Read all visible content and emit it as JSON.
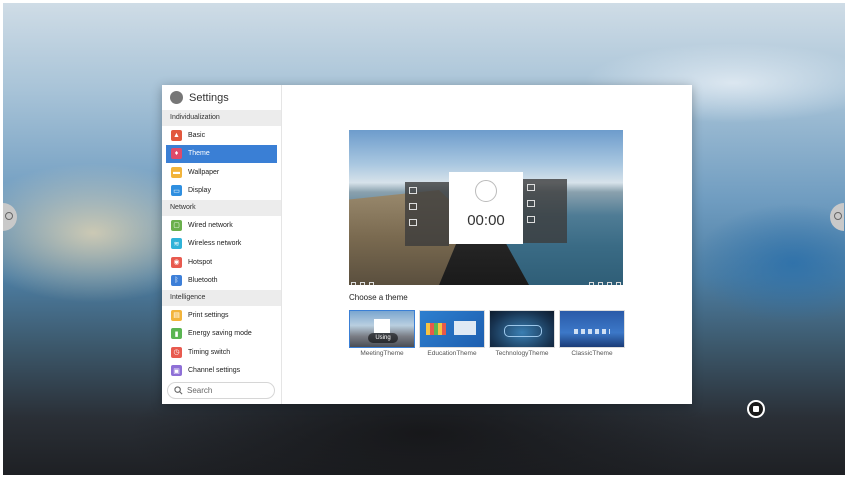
{
  "settings": {
    "title": "Settings",
    "sections": {
      "individualization": "Individualization",
      "network": "Network",
      "intelligence": "Intelligence"
    },
    "items": {
      "basic": "Basic",
      "theme": "Theme",
      "wallpaper": "Wallpaper",
      "display": "Display",
      "wired_network": "Wired network",
      "wireless_network": "Wireless network",
      "hotspot": "Hotspot",
      "bluetooth": "Bluetooth",
      "print_settings": "Print settings",
      "energy_saving_mode": "Energy saving mode",
      "timing_switch": "Timing switch",
      "channel_settings": "Channel settings"
    },
    "selected_item": "Theme",
    "search_placeholder": "Search"
  },
  "theme_page": {
    "preview": {
      "time": "00:00"
    },
    "choose_label": "Choose a theme",
    "themes": [
      {
        "name": "MeetingTheme",
        "badge": "Using"
      },
      {
        "name": "EducationTheme"
      },
      {
        "name": "TechnologyTheme"
      },
      {
        "name": "ClassicTheme"
      }
    ]
  },
  "colors": {
    "accent": "#3a7fd5",
    "basic_icon": "#e2583e",
    "theme_icon": "#e04a6a",
    "wallpaper_icon": "#f2b43b",
    "display_icon": "#2f8fe0",
    "wired_icon": "#6ab04c",
    "wireless_icon": "#2fb3d8",
    "hotspot_icon": "#e85a4f",
    "bluetooth_icon": "#3d7fd8",
    "print_icon": "#f2b43b",
    "energy_icon": "#5ab552",
    "timing_icon": "#e85a4f",
    "channel_icon": "#8e6fd6"
  }
}
